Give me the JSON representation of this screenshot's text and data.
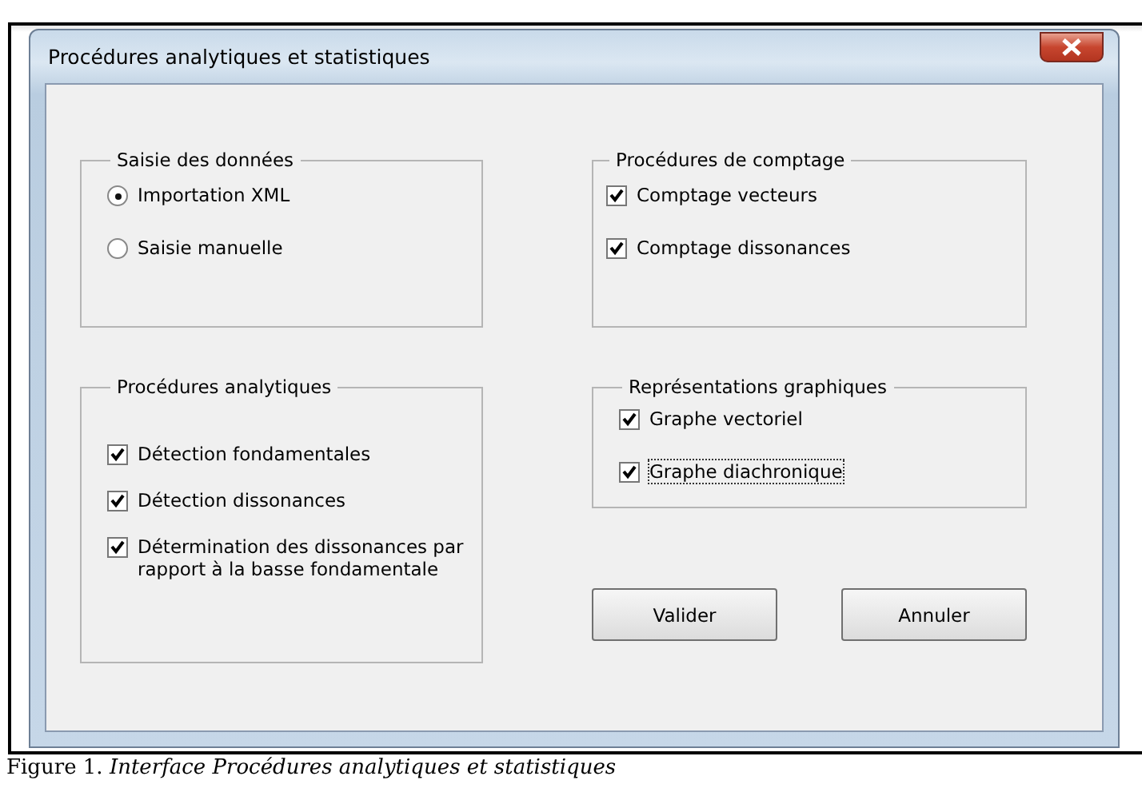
{
  "window": {
    "title": "Procédures analytiques et statistiques"
  },
  "columns": [
    {
      "groups": [
        {
          "title": "Saisie des données",
          "items": [
            {
              "kind": "radio",
              "label": "Importation XML",
              "selected": true,
              "focused": false
            },
            {
              "kind": "radio",
              "label": "Saisie manuelle",
              "selected": false,
              "focused": false
            }
          ]
        },
        {
          "title": "Procédures analytiques",
          "items": [
            {
              "kind": "checkbox",
              "label": "Détection fondamentales",
              "checked": true,
              "focused": false
            },
            {
              "kind": "checkbox",
              "label": "Détection dissonances",
              "checked": true,
              "focused": false
            },
            {
              "kind": "checkbox",
              "label": "Détermination des dissonances par rapport à la basse fondamentale",
              "checked": true,
              "focused": false
            }
          ]
        }
      ]
    },
    {
      "groups": [
        {
          "title": "Procédures de comptage",
          "items": [
            {
              "kind": "checkbox",
              "label": "Comptage vecteurs",
              "checked": true,
              "focused": false
            },
            {
              "kind": "checkbox",
              "label": "Comptage dissonances",
              "checked": true,
              "focused": false
            }
          ]
        },
        {
          "title": "Représentations graphiques",
          "items": [
            {
              "kind": "checkbox",
              "label": "Graphe vectoriel",
              "checked": true,
              "focused": false
            },
            {
              "kind": "checkbox",
              "label": "Graphe diachronique",
              "checked": true,
              "focused": true
            }
          ]
        }
      ]
    }
  ],
  "buttons": [
    "Valider",
    "Annuler"
  ],
  "caption": "Figure 1. *Interface Procédures analytiques et statistiques*"
}
